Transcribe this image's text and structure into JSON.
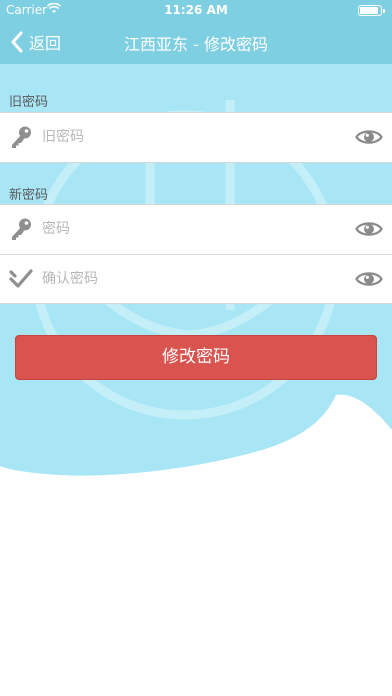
{
  "status_bar": {
    "carrier": "Carrier",
    "time": "11:26 AM"
  },
  "nav": {
    "back_label": "返回",
    "title": "江西亚东 - 修改密码"
  },
  "old_password": {
    "section_label": "旧密码",
    "placeholder": "旧密码"
  },
  "new_password": {
    "section_label": "新密码",
    "password_placeholder": "密码",
    "confirm_placeholder": "确认密码"
  },
  "submit_label": "修改密码",
  "colors": {
    "header": "#7fcfe3",
    "background_wave": "#a9e6f5",
    "submit": "#d9534f"
  },
  "icons": {
    "key": "key-icon",
    "check": "checkmark-icon",
    "eye": "eye-icon",
    "back": "chevron-left-icon"
  }
}
